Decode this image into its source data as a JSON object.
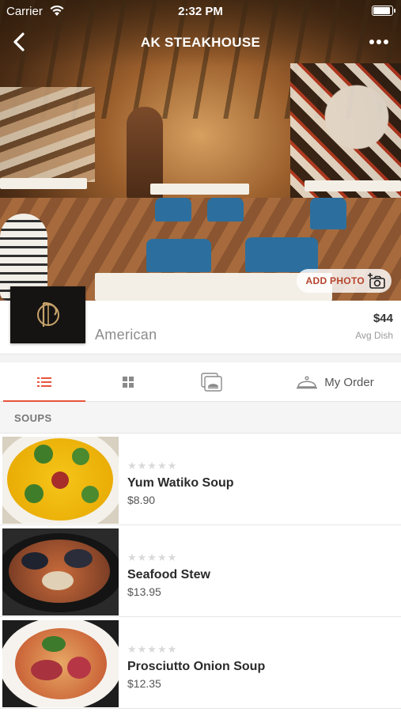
{
  "status_bar": {
    "carrier": "Carrier",
    "time": "2:32 PM",
    "battery_level": 0.95
  },
  "nav": {
    "title": "AK STEAKHOUSE"
  },
  "hero": {
    "add_photo_label": "ADD PHOTO"
  },
  "restaurant": {
    "cuisine": "American",
    "avg_price": "$44",
    "avg_price_label": "Avg Dish"
  },
  "tabs": {
    "active_index": 0,
    "order_label": "My Order"
  },
  "section": {
    "title": "SOUPS"
  },
  "items": [
    {
      "name": "Yum Watiko Soup",
      "price": "$8.90",
      "rating": 0,
      "stars": "★★★★★"
    },
    {
      "name": "Seafood Stew",
      "price": "$13.95",
      "rating": 0,
      "stars": "★★★★★"
    },
    {
      "name": "Prosciutto Onion Soup",
      "price": "$12.35",
      "rating": 0,
      "stars": "★★★★★"
    }
  ],
  "colors": {
    "accent": "#e8543c",
    "add_photo_text": "#b5442c",
    "chair_blue": "#2c6f9e"
  }
}
